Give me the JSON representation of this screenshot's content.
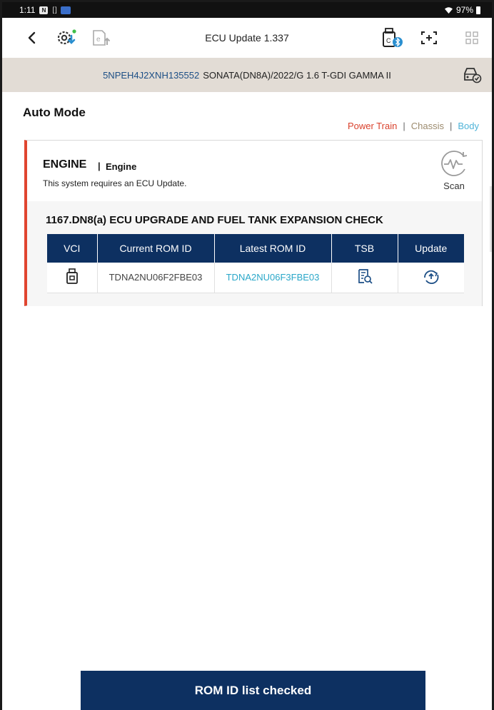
{
  "status_bar": {
    "time": "1:11",
    "badge_n": "N",
    "brackets": "[ ]",
    "battery_text": "97%"
  },
  "app_bar": {
    "title": "ECU Update 1.337",
    "icons": [
      "back-arrow-icon",
      "ecu-download-icon",
      "e-upload-icon",
      "vci-bluetooth-icon",
      "capture-icon",
      "grid-menu-icon"
    ]
  },
  "vehicle": {
    "vin": "5NPEH4J2XNH135552",
    "description": "SONATA(DN8A)/2022/G 1.6 T-GDI GAMMA II"
  },
  "mode": {
    "title": "Auto Mode",
    "filters": [
      {
        "label": "Power Train",
        "color": "#d9412c"
      },
      {
        "label": "Chassis",
        "color": "#9c8b6e"
      },
      {
        "label": "Body",
        "color": "#4eb3d8"
      }
    ]
  },
  "system": {
    "name": "ENGINE",
    "separator": "|",
    "sub_name": "Engine",
    "message": "This system requires an ECU Update.",
    "scan_label": "Scan",
    "accent_color": "#e0452f"
  },
  "campaign": {
    "title": "1167.DN8(a) ECU UPGRADE AND FUEL TANK EXPANSION CHECK",
    "columns": [
      "VCI",
      "Current ROM ID",
      "Latest ROM ID",
      "TSB",
      "Update"
    ],
    "rows": [
      {
        "current_rom": "TDNA2NU06F2FBE03",
        "latest_rom": "TDNA2NU06F3FBE03"
      }
    ]
  },
  "footer": {
    "button_label": "ROM ID list checked"
  },
  "colors": {
    "navy": "#0d3061",
    "vehicle_bar": "#e2dcd5",
    "link": "#2aa7c9"
  }
}
